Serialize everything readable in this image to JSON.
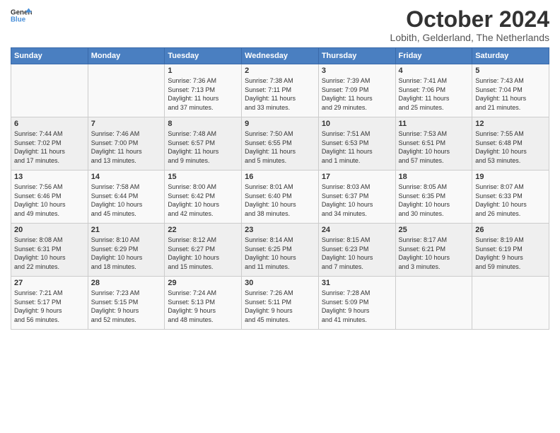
{
  "logo": {
    "line1": "General",
    "line2": "Blue"
  },
  "title": "October 2024",
  "location": "Lobith, Gelderland, The Netherlands",
  "weekdays": [
    "Sunday",
    "Monday",
    "Tuesday",
    "Wednesday",
    "Thursday",
    "Friday",
    "Saturday"
  ],
  "weeks": [
    [
      {
        "day": "",
        "info": ""
      },
      {
        "day": "",
        "info": ""
      },
      {
        "day": "1",
        "info": "Sunrise: 7:36 AM\nSunset: 7:13 PM\nDaylight: 11 hours\nand 37 minutes."
      },
      {
        "day": "2",
        "info": "Sunrise: 7:38 AM\nSunset: 7:11 PM\nDaylight: 11 hours\nand 33 minutes."
      },
      {
        "day": "3",
        "info": "Sunrise: 7:39 AM\nSunset: 7:09 PM\nDaylight: 11 hours\nand 29 minutes."
      },
      {
        "day": "4",
        "info": "Sunrise: 7:41 AM\nSunset: 7:06 PM\nDaylight: 11 hours\nand 25 minutes."
      },
      {
        "day": "5",
        "info": "Sunrise: 7:43 AM\nSunset: 7:04 PM\nDaylight: 11 hours\nand 21 minutes."
      }
    ],
    [
      {
        "day": "6",
        "info": "Sunrise: 7:44 AM\nSunset: 7:02 PM\nDaylight: 11 hours\nand 17 minutes."
      },
      {
        "day": "7",
        "info": "Sunrise: 7:46 AM\nSunset: 7:00 PM\nDaylight: 11 hours\nand 13 minutes."
      },
      {
        "day": "8",
        "info": "Sunrise: 7:48 AM\nSunset: 6:57 PM\nDaylight: 11 hours\nand 9 minutes."
      },
      {
        "day": "9",
        "info": "Sunrise: 7:50 AM\nSunset: 6:55 PM\nDaylight: 11 hours\nand 5 minutes."
      },
      {
        "day": "10",
        "info": "Sunrise: 7:51 AM\nSunset: 6:53 PM\nDaylight: 11 hours\nand 1 minute."
      },
      {
        "day": "11",
        "info": "Sunrise: 7:53 AM\nSunset: 6:51 PM\nDaylight: 10 hours\nand 57 minutes."
      },
      {
        "day": "12",
        "info": "Sunrise: 7:55 AM\nSunset: 6:48 PM\nDaylight: 10 hours\nand 53 minutes."
      }
    ],
    [
      {
        "day": "13",
        "info": "Sunrise: 7:56 AM\nSunset: 6:46 PM\nDaylight: 10 hours\nand 49 minutes."
      },
      {
        "day": "14",
        "info": "Sunrise: 7:58 AM\nSunset: 6:44 PM\nDaylight: 10 hours\nand 45 minutes."
      },
      {
        "day": "15",
        "info": "Sunrise: 8:00 AM\nSunset: 6:42 PM\nDaylight: 10 hours\nand 42 minutes."
      },
      {
        "day": "16",
        "info": "Sunrise: 8:01 AM\nSunset: 6:40 PM\nDaylight: 10 hours\nand 38 minutes."
      },
      {
        "day": "17",
        "info": "Sunrise: 8:03 AM\nSunset: 6:37 PM\nDaylight: 10 hours\nand 34 minutes."
      },
      {
        "day": "18",
        "info": "Sunrise: 8:05 AM\nSunset: 6:35 PM\nDaylight: 10 hours\nand 30 minutes."
      },
      {
        "day": "19",
        "info": "Sunrise: 8:07 AM\nSunset: 6:33 PM\nDaylight: 10 hours\nand 26 minutes."
      }
    ],
    [
      {
        "day": "20",
        "info": "Sunrise: 8:08 AM\nSunset: 6:31 PM\nDaylight: 10 hours\nand 22 minutes."
      },
      {
        "day": "21",
        "info": "Sunrise: 8:10 AM\nSunset: 6:29 PM\nDaylight: 10 hours\nand 18 minutes."
      },
      {
        "day": "22",
        "info": "Sunrise: 8:12 AM\nSunset: 6:27 PM\nDaylight: 10 hours\nand 15 minutes."
      },
      {
        "day": "23",
        "info": "Sunrise: 8:14 AM\nSunset: 6:25 PM\nDaylight: 10 hours\nand 11 minutes."
      },
      {
        "day": "24",
        "info": "Sunrise: 8:15 AM\nSunset: 6:23 PM\nDaylight: 10 hours\nand 7 minutes."
      },
      {
        "day": "25",
        "info": "Sunrise: 8:17 AM\nSunset: 6:21 PM\nDaylight: 10 hours\nand 3 minutes."
      },
      {
        "day": "26",
        "info": "Sunrise: 8:19 AM\nSunset: 6:19 PM\nDaylight: 9 hours\nand 59 minutes."
      }
    ],
    [
      {
        "day": "27",
        "info": "Sunrise: 7:21 AM\nSunset: 5:17 PM\nDaylight: 9 hours\nand 56 minutes."
      },
      {
        "day": "28",
        "info": "Sunrise: 7:23 AM\nSunset: 5:15 PM\nDaylight: 9 hours\nand 52 minutes."
      },
      {
        "day": "29",
        "info": "Sunrise: 7:24 AM\nSunset: 5:13 PM\nDaylight: 9 hours\nand 48 minutes."
      },
      {
        "day": "30",
        "info": "Sunrise: 7:26 AM\nSunset: 5:11 PM\nDaylight: 9 hours\nand 45 minutes."
      },
      {
        "day": "31",
        "info": "Sunrise: 7:28 AM\nSunset: 5:09 PM\nDaylight: 9 hours\nand 41 minutes."
      },
      {
        "day": "",
        "info": ""
      },
      {
        "day": "",
        "info": ""
      }
    ]
  ]
}
